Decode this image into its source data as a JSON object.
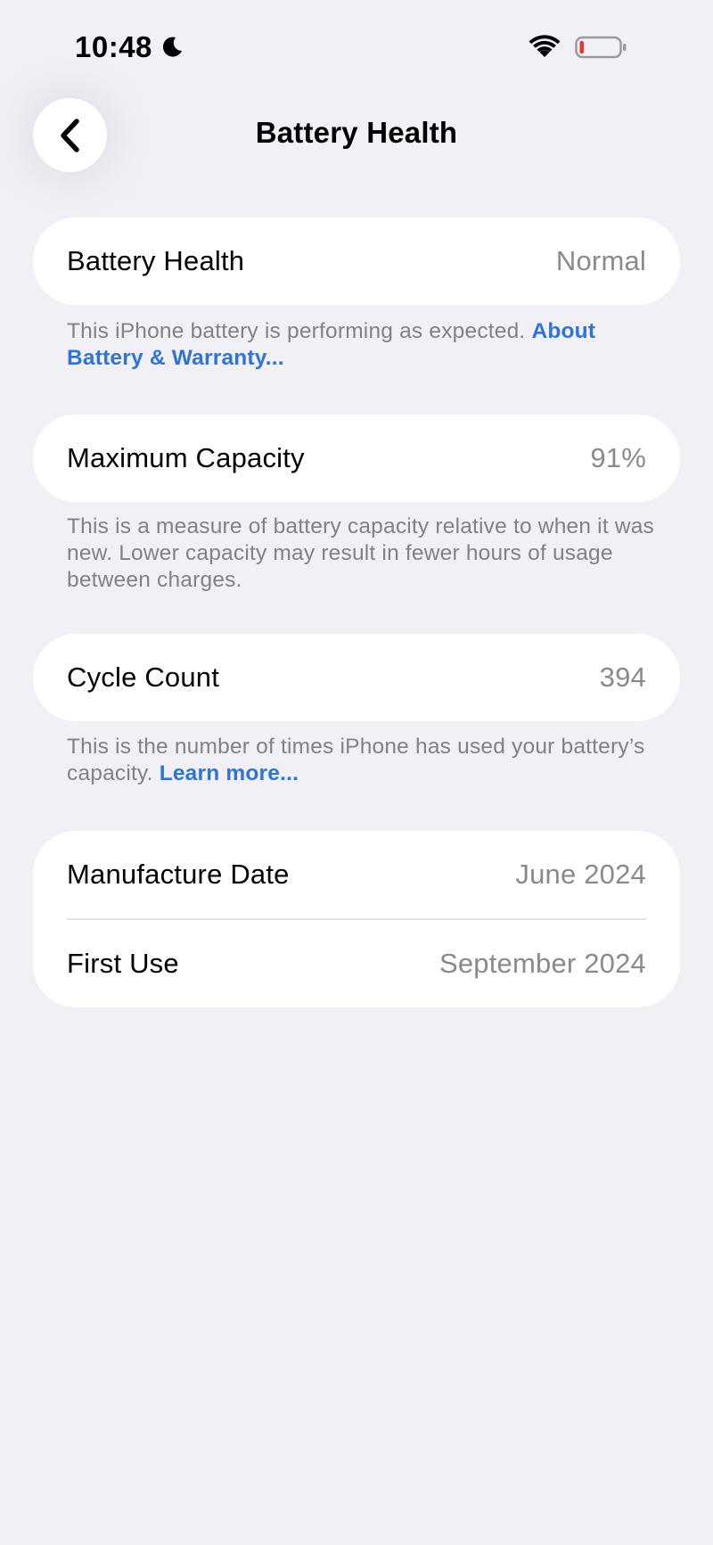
{
  "status_bar": {
    "time": "10:48",
    "focus_icon": "moon-icon",
    "wifi_icon": "wifi-icon",
    "battery_icon": "battery-low-icon",
    "battery_color": "#e5392f"
  },
  "nav": {
    "back_icon": "chevron-left-icon",
    "title": "Battery Health"
  },
  "sections": {
    "health": {
      "label": "Battery Health",
      "value": "Normal",
      "footnote_text": "This iPhone battery is performing as expected. ",
      "footnote_link": "About Battery & Warranty..."
    },
    "capacity": {
      "label": "Maximum Capacity",
      "value": "91%",
      "footnote_text": "This is a measure of battery capacity relative to when it was new. Lower capacity may result in fewer hours of usage between charges."
    },
    "cycles": {
      "label": "Cycle Count",
      "value": "394",
      "footnote_text": "This is the number of times iPhone has used your battery’s capacity. ",
      "footnote_link": "Learn more..."
    },
    "dates": {
      "manufacture_label": "Manufacture Date",
      "manufacture_value": "June 2024",
      "first_use_label": "First Use",
      "first_use_value": "September 2024"
    }
  },
  "colors": {
    "background": "#f1f0f6",
    "card": "#ffffff",
    "secondary_text": "#8a8a8e",
    "link": "#2f73d6"
  }
}
